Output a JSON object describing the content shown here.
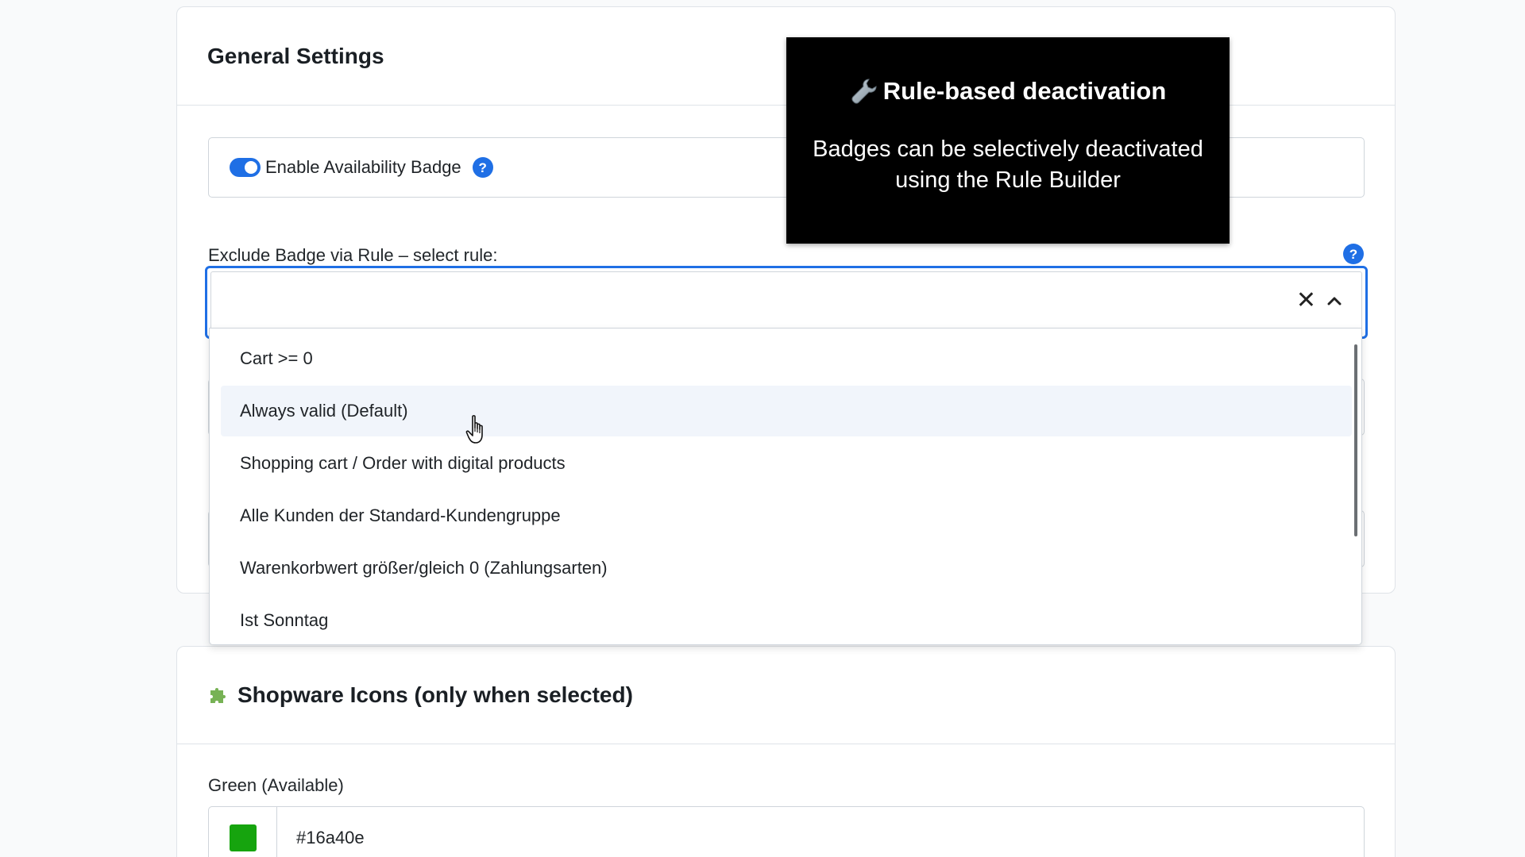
{
  "general": {
    "title": "General Settings",
    "toggle_label": "Enable Availability Badge",
    "toggle_on": true,
    "help_glyph": "?",
    "rule_label": "Exclude Badge via Rule – select rule:",
    "select_value": "",
    "clear_glyph": "✕",
    "dropdown_items": [
      {
        "label": "Cart >= 0"
      },
      {
        "label": "Always valid (Default)"
      },
      {
        "label": "Shopping cart / Order with digital products"
      },
      {
        "label": "Alle Kunden der Standard-Kundengruppe"
      },
      {
        "label": "Warenkorbwert größer/gleich 0 (Zahlungsarten)"
      },
      {
        "label": "Ist Sonntag"
      }
    ]
  },
  "overlay": {
    "title": "Rule-based deactivation",
    "icon": "wrench-icon",
    "body": "Badges can be selectively deactivated using the Rule Builder"
  },
  "icons_section": {
    "icon": "puzzle-icon",
    "title": "Shopware Icons (only when selected)",
    "green_label": "Green (Available)",
    "green_value": "#16a40e"
  },
  "colors": {
    "accent": "#1f6fe5",
    "green_swatch": "#16a40e"
  }
}
